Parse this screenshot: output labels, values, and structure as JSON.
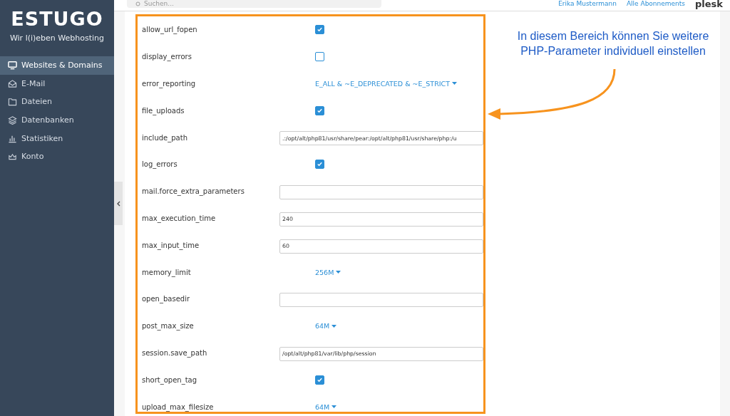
{
  "sidebar": {
    "brand": "ESTUGO",
    "tagline": "Wir l(i)eben Webhosting",
    "items": [
      {
        "label": "Websites & Domains",
        "selected": true
      },
      {
        "label": "E-Mail",
        "selected": false
      },
      {
        "label": "Dateien",
        "selected": false
      },
      {
        "label": "Datenbanken",
        "selected": false
      },
      {
        "label": "Statistiken",
        "selected": false
      },
      {
        "label": "Konto",
        "selected": false
      }
    ]
  },
  "header": {
    "search": {
      "placeholder": "Suchen..."
    },
    "user": "Erika Mustermann",
    "subscriptions": "Alle Abonnements",
    "logo": "plesk"
  },
  "settings": [
    {
      "name": "allow_url_fopen",
      "kind": "checkbox",
      "checked": true
    },
    {
      "name": "display_errors",
      "kind": "checkbox",
      "checked": false
    },
    {
      "name": "error_reporting",
      "kind": "select",
      "value": "E_ALL & ~E_DEPRECATED & ~E_STRICT"
    },
    {
      "name": "file_uploads",
      "kind": "checkbox",
      "checked": true
    },
    {
      "name": "include_path",
      "kind": "text",
      "value": ".:/opt/alt/php81/usr/share/pear:/opt/alt/php81/usr/share/php:/u"
    },
    {
      "name": "log_errors",
      "kind": "checkbox",
      "checked": true
    },
    {
      "name": "mail.force_extra_parameters",
      "kind": "text"
    },
    {
      "name": "max_execution_time",
      "kind": "text",
      "value": "240"
    },
    {
      "name": "max_input_time",
      "kind": "text",
      "value": "60"
    },
    {
      "name": "memory_limit",
      "kind": "select",
      "value": "256M"
    },
    {
      "name": "open_basedir",
      "kind": "text"
    },
    {
      "name": "post_max_size",
      "kind": "select",
      "value": "64M"
    },
    {
      "name": "session.save_path",
      "kind": "text",
      "value": "/opt/alt/php81/var/lib/php/session"
    },
    {
      "name": "short_open_tag",
      "kind": "checkbox",
      "checked": true
    },
    {
      "name": "upload_max_filesize",
      "kind": "select",
      "value": "64M"
    }
  ],
  "annotation": "In diesem Bereich können Sie weitere PHP-Parameter individuell einstellen"
}
